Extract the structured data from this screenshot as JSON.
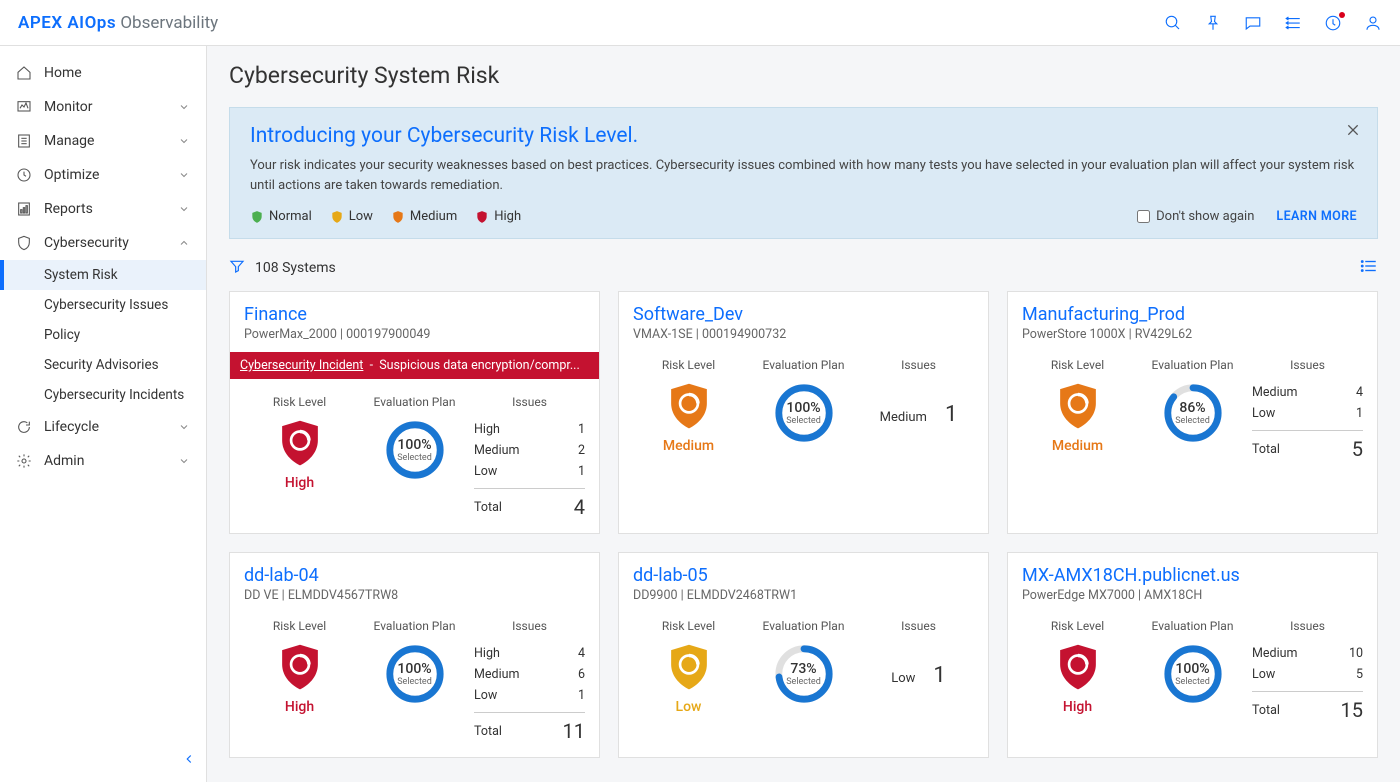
{
  "brand": {
    "main": "APEX AIOps",
    "sub": "Observability"
  },
  "nav": {
    "home": "Home",
    "monitor": "Monitor",
    "manage": "Manage",
    "optimize": "Optimize",
    "reports": "Reports",
    "cybersecurity": "Cybersecurity",
    "lifecycle": "Lifecycle",
    "admin": "Admin",
    "sub": {
      "system_risk": "System Risk",
      "issues": "Cybersecurity Issues",
      "policy": "Policy",
      "advisories": "Security Advisories",
      "incidents": "Cybersecurity Incidents"
    }
  },
  "page_title": "Cybersecurity System Risk",
  "banner": {
    "title": "Introducing your Cybersecurity Risk Level.",
    "text": "Your risk indicates your security weaknesses based on best practices. Cybersecurity issues combined with how many tests you have selected in your evaluation plan will affect your system risk until actions are taken towards remediation.",
    "legend": {
      "normal": "Normal",
      "low": "Low",
      "medium": "Medium",
      "high": "High"
    },
    "dont_show": "Don't show again",
    "learn_more": "LEARN MORE"
  },
  "filter": {
    "systems_count": "108 Systems"
  },
  "card_labels": {
    "risk": "Risk Level",
    "plan": "Evaluation Plan",
    "issues": "Issues",
    "selected": "Selected",
    "total": "Total"
  },
  "issue_labels": {
    "high": "High",
    "medium": "Medium",
    "low": "Low"
  },
  "cards": [
    {
      "name": "Finance",
      "sub": "PowerMax_2000 | 000197900049",
      "incident_label": "Cybersecurity Incident",
      "incident_text": "Suspicious data encryption/compr...",
      "risk": "High",
      "plan_pct": "100%",
      "plan_fill": 100,
      "issues": {
        "high": "1",
        "medium": "2",
        "low": "1",
        "total": "4"
      }
    },
    {
      "name": "Software_Dev",
      "sub": "VMAX-1SE | 000194900732",
      "risk": "Medium",
      "plan_pct": "100%",
      "plan_fill": 100,
      "single_issue": {
        "label": "Medium",
        "value": "1"
      }
    },
    {
      "name": "Manufacturing_Prod",
      "sub": "PowerStore 1000X | RV429L62",
      "risk": "Medium",
      "plan_pct": "86%",
      "plan_fill": 86,
      "issues": {
        "medium": "4",
        "low": "1",
        "total": "5"
      }
    },
    {
      "name": "dd-lab-04",
      "sub": "DD VE | ELMDDV4567TRW8",
      "risk": "High",
      "plan_pct": "100%",
      "plan_fill": 100,
      "issues": {
        "high": "4",
        "medium": "6",
        "low": "1",
        "total": "11"
      }
    },
    {
      "name": "dd-lab-05",
      "sub": "DD9900 | ELMDDV2468TRW1",
      "risk": "Low",
      "plan_pct": "73%",
      "plan_fill": 73,
      "single_issue": {
        "label": "Low",
        "value": "1"
      }
    },
    {
      "name": "MX-AMX18CH.publicnet.us",
      "sub": "PowerEdge MX7000 | AMX18CH",
      "risk": "High",
      "plan_pct": "100%",
      "plan_fill": 100,
      "issues": {
        "medium": "10",
        "low": "5",
        "total": "15"
      }
    }
  ]
}
